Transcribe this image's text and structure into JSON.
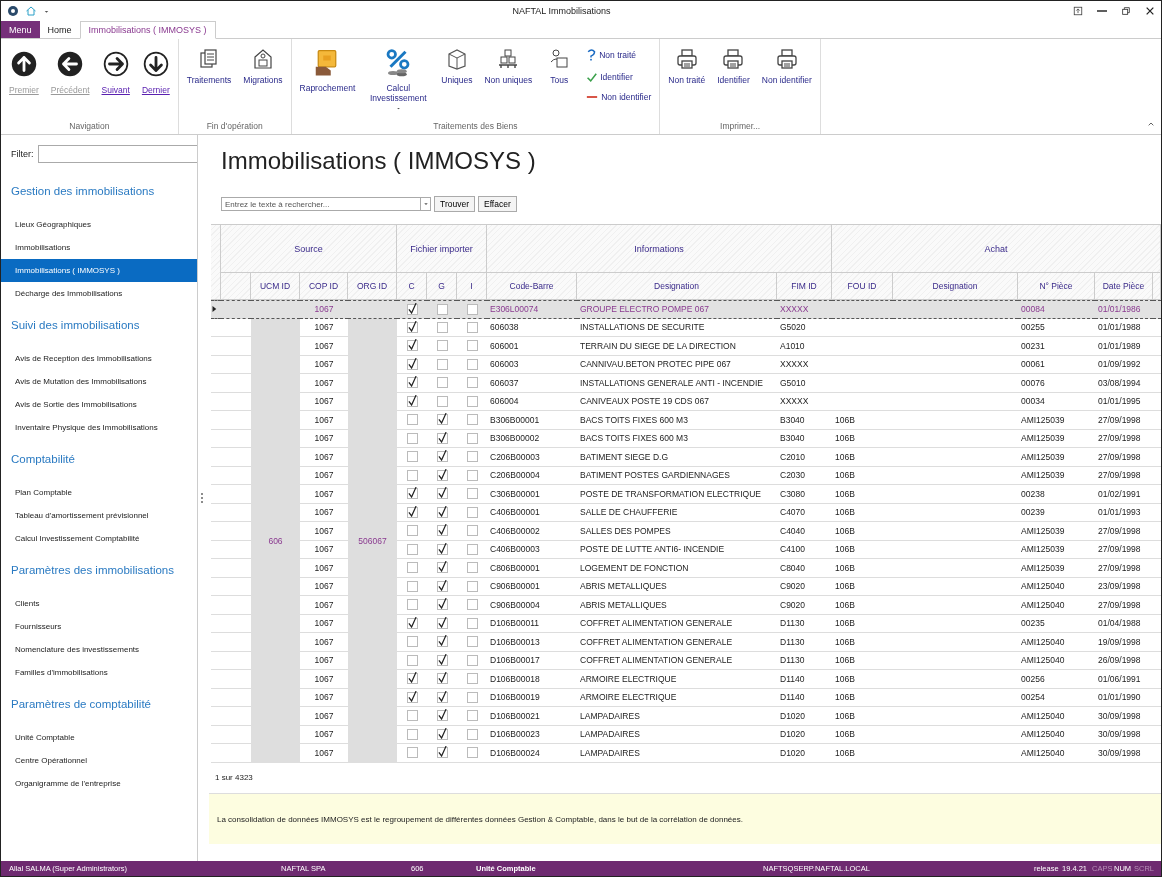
{
  "window": {
    "title": "NAFTAL Immobilisations"
  },
  "ribbon": {
    "tabs": [
      {
        "label": "Menu",
        "kind": "menu",
        "selected": false
      },
      {
        "label": "Home",
        "kind": "tab",
        "selected": false
      },
      {
        "label": "Immobilisations ( IMMOSYS )",
        "kind": "tab",
        "selected": true
      }
    ],
    "groups": [
      {
        "label": "Navigation",
        "buttons": [
          {
            "label": "Premier",
            "kind": "nav",
            "disabled": true
          },
          {
            "label": "Précédent",
            "kind": "nav",
            "disabled": true
          },
          {
            "label": "Suivant",
            "kind": "nav",
            "disabled": false
          },
          {
            "label": "Dernier",
            "kind": "nav",
            "disabled": false
          }
        ]
      },
      {
        "label": "Fin d'opération",
        "buttons": [
          {
            "label": "Traitements",
            "kind": "large",
            "disabled": false
          },
          {
            "label": "Migrations",
            "kind": "large",
            "disabled": false
          }
        ]
      },
      {
        "label": "Traitements des Biens",
        "buttons": [
          {
            "label": "Raprochement",
            "kind": "large",
            "disabled": false
          },
          {
            "label": "Calcul Investissement",
            "kind": "split",
            "disabled": false
          },
          {
            "label": "Uniques",
            "kind": "large",
            "disabled": false
          },
          {
            "label": "Non uniques",
            "kind": "large",
            "disabled": false
          },
          {
            "label": "Tous",
            "kind": "large",
            "disabled": false
          },
          {
            "label": "Non traité",
            "kind": "small",
            "disabled": false
          },
          {
            "label": "Identifier",
            "kind": "small",
            "disabled": false
          },
          {
            "label": "Non identifier",
            "kind": "small",
            "disabled": false
          }
        ]
      },
      {
        "label": "Imprimer...",
        "buttons": [
          {
            "label": "Non traité",
            "kind": "large",
            "disabled": false
          },
          {
            "label": "Identifier",
            "kind": "large",
            "disabled": false
          },
          {
            "label": "Non identifier",
            "kind": "large",
            "disabled": false
          }
        ]
      }
    ]
  },
  "sidebar": {
    "filter_label": "Filter:",
    "sections": [
      {
        "title": "Gestion des immobilisations",
        "items": [
          {
            "label": "Lieux Géographiques",
            "selected": false
          },
          {
            "label": "Immobilisations",
            "selected": false
          },
          {
            "label": "Immobilisations ( IMMOSYS )",
            "selected": true
          },
          {
            "label": "Décharge des Immobilisations",
            "selected": false
          }
        ]
      },
      {
        "title": "Suivi des immobilisations",
        "items": [
          {
            "label": "Avis de Reception des Immobilisations",
            "selected": false
          },
          {
            "label": "Avis de Mutation des Immobilisations",
            "selected": false
          },
          {
            "label": "Avis de Sortie des Immobilisations",
            "selected": false
          },
          {
            "label": "Inventaire Physique des Immobilisations",
            "selected": false
          }
        ]
      },
      {
        "title": "Comptabilité",
        "items": [
          {
            "label": "Plan Comptable",
            "selected": false
          },
          {
            "label": "Tableau d'amortissement prévisionnel",
            "selected": false
          },
          {
            "label": "Calcul Investissement Comptabilité",
            "selected": false
          }
        ]
      },
      {
        "title": "Paramètres des immobilisations",
        "items": [
          {
            "label": "Clients",
            "selected": false
          },
          {
            "label": "Fournisseurs",
            "selected": false
          },
          {
            "label": "Nomenclature des investissements",
            "selected": false
          },
          {
            "label": "Familles d'immobilisations",
            "selected": false
          }
        ]
      },
      {
        "title": "Paramètres de comptabilité",
        "items": [
          {
            "label": "Unité Comptable",
            "selected": false
          },
          {
            "label": "Centre Opérationnel",
            "selected": false
          },
          {
            "label": "Organigramme de l'entreprise",
            "selected": false
          }
        ]
      }
    ]
  },
  "page": {
    "title": "Immobilisations ( IMMOSYS )"
  },
  "search": {
    "placeholder": "Entrez le texte à rechercher...",
    "buttons": [
      "Trouver",
      "Effacer"
    ]
  },
  "table": {
    "groups": [
      {
        "label": "Source"
      },
      {
        "label": "Fichier importer"
      },
      {
        "label": "Informations"
      },
      {
        "label": "Achat"
      }
    ],
    "columns": [
      "UCM ID",
      "COP ID",
      "ORG ID",
      "C",
      "G",
      "I",
      "Code-Barre",
      "Designation",
      "FIM ID",
      "FOU ID",
      "Designation",
      "N° Pièce",
      "Date Pièce"
    ],
    "ucm_id": "606",
    "org_id": "506067",
    "rows": [
      {
        "selected": true,
        "cop_id": "1067",
        "c": true,
        "g": false,
        "i": false,
        "code_barre": "E306L00074",
        "designation": "GROUPE ELECTRO POMPE 067",
        "fim_id": "XXXXX",
        "n_piece": "00084",
        "date_piece": "01/01/1986"
      },
      {
        "selected": false,
        "cop_id": "1067",
        "c": true,
        "g": false,
        "i": false,
        "code_barre": "606038",
        "designation": "INSTALLATIONS DE SECURITE",
        "fim_id": "G5020",
        "n_piece": "00255",
        "date_piece": "01/01/1988"
      },
      {
        "selected": false,
        "cop_id": "1067",
        "c": true,
        "g": false,
        "i": false,
        "code_barre": "606001",
        "designation": "TERRAIN DU SIEGE DE LA DIRECTION",
        "fim_id": "A1010",
        "n_piece": "00231",
        "date_piece": "01/01/1989"
      },
      {
        "selected": false,
        "cop_id": "1067",
        "c": true,
        "g": false,
        "i": false,
        "code_barre": "606003",
        "designation": "CANNIVAU.BETON PROTEC PIPE 067",
        "fim_id": "XXXXX",
        "n_piece": "00061",
        "date_piece": "01/09/1992"
      },
      {
        "selected": false,
        "cop_id": "1067",
        "c": true,
        "g": false,
        "i": false,
        "code_barre": "606037",
        "designation": "INSTALLATIONS GENERALE  ANTI - INCENDIE",
        "fim_id": "G5010",
        "n_piece": "00076",
        "date_piece": "03/08/1994"
      },
      {
        "selected": false,
        "cop_id": "1067",
        "c": true,
        "g": false,
        "i": false,
        "code_barre": "606004",
        "designation": "CANIVEAUX POSTE 19 CDS 067",
        "fim_id": "XXXXX",
        "n_piece": "00034",
        "date_piece": "01/01/1995"
      },
      {
        "selected": false,
        "cop_id": "1067",
        "c": false,
        "g": true,
        "i": false,
        "code_barre": "B306B00001",
        "designation": "BACS TOITS FIXES 600 M3",
        "fim_id": "B3040",
        "fou_id": "106B",
        "n_piece": "AMI125039",
        "date_piece": "27/09/1998"
      },
      {
        "selected": false,
        "cop_id": "1067",
        "c": false,
        "g": true,
        "i": false,
        "code_barre": "B306B00002",
        "designation": "BACS TOITS FIXES 600 M3",
        "fim_id": "B3040",
        "fou_id": "106B",
        "n_piece": "AMI125039",
        "date_piece": "27/09/1998"
      },
      {
        "selected": false,
        "cop_id": "1067",
        "c": false,
        "g": true,
        "i": false,
        "code_barre": "C206B00003",
        "designation": "BATIMENT SIEGE D.G",
        "fim_id": "C2010",
        "fou_id": "106B",
        "n_piece": "AMI125039",
        "date_piece": "27/09/1998"
      },
      {
        "selected": false,
        "cop_id": "1067",
        "c": false,
        "g": true,
        "i": false,
        "code_barre": "C206B00004",
        "designation": "BATIMENT  POSTES GARDIENNAGES",
        "fim_id": "C2030",
        "fou_id": "106B",
        "n_piece": "AMI125039",
        "date_piece": "27/09/1998"
      },
      {
        "selected": false,
        "cop_id": "1067",
        "c": true,
        "g": true,
        "i": false,
        "code_barre": "C306B00001",
        "designation": "POSTE DE TRANSFORMATION ELECTRIQUE",
        "fim_id": "C3080",
        "fou_id": "106B",
        "n_piece": "00238",
        "date_piece": "01/02/1991"
      },
      {
        "selected": false,
        "cop_id": "1067",
        "c": true,
        "g": true,
        "i": false,
        "code_barre": "C406B00001",
        "designation": "SALLE DE CHAUFFERIE",
        "fim_id": "C4070",
        "fou_id": "106B",
        "n_piece": "00239",
        "date_piece": "01/01/1993"
      },
      {
        "selected": false,
        "cop_id": "1067",
        "c": false,
        "g": true,
        "i": false,
        "code_barre": "C406B00002",
        "designation": "SALLES DES POMPES",
        "fim_id": "C4040",
        "fou_id": "106B",
        "n_piece": "AMI125039",
        "date_piece": "27/09/1998"
      },
      {
        "selected": false,
        "cop_id": "1067",
        "c": false,
        "g": true,
        "i": false,
        "code_barre": "C406B00003",
        "designation": "POSTE DE LUTTE ANTI6- INCENDIE",
        "fim_id": "C4100",
        "fou_id": "106B",
        "n_piece": "AMI125039",
        "date_piece": "27/09/1998"
      },
      {
        "selected": false,
        "cop_id": "1067",
        "c": false,
        "g": true,
        "i": false,
        "code_barre": "C806B00001",
        "designation": "LOGEMENT DE FONCTION",
        "fim_id": "C8040",
        "fou_id": "106B",
        "n_piece": "AMI125039",
        "date_piece": "27/09/1998"
      },
      {
        "selected": false,
        "cop_id": "1067",
        "c": false,
        "g": true,
        "i": false,
        "code_barre": "C906B00001",
        "designation": "ABRIS METALLIQUES",
        "fim_id": "C9020",
        "fou_id": "106B",
        "n_piece": "AMI125040",
        "date_piece": "23/09/1998"
      },
      {
        "selected": false,
        "cop_id": "1067",
        "c": false,
        "g": true,
        "i": false,
        "code_barre": "C906B00004",
        "designation": "ABRIS METALLIQUES",
        "fim_id": "C9020",
        "fou_id": "106B",
        "n_piece": "AMI125040",
        "date_piece": "27/09/1998"
      },
      {
        "selected": false,
        "cop_id": "1067",
        "c": true,
        "g": true,
        "i": false,
        "code_barre": "D106B00011",
        "designation": "COFFRET ALIMENTATION  GENERALE",
        "fim_id": "D1130",
        "fou_id": "106B",
        "n_piece": "00235",
        "date_piece": "01/04/1988"
      },
      {
        "selected": false,
        "cop_id": "1067",
        "c": false,
        "g": true,
        "i": false,
        "code_barre": "D106B00013",
        "designation": "COFFRET ALIMENTATION  GENERALE",
        "fim_id": "D1130",
        "fou_id": "106B",
        "n_piece": "AMI125040",
        "date_piece": "19/09/1998"
      },
      {
        "selected": false,
        "cop_id": "1067",
        "c": false,
        "g": true,
        "i": false,
        "code_barre": "D106B00017",
        "designation": "COFFRET ALIMENTATION  GENERALE",
        "fim_id": "D1130",
        "fou_id": "106B",
        "n_piece": "AMI125040",
        "date_piece": "26/09/1998"
      },
      {
        "selected": false,
        "cop_id": "1067",
        "c": true,
        "g": true,
        "i": false,
        "code_barre": "D106B00018",
        "designation": "ARMOIRE ELECTRIQUE",
        "fim_id": "D1140",
        "fou_id": "106B",
        "n_piece": "00256",
        "date_piece": "01/06/1991"
      },
      {
        "selected": false,
        "cop_id": "1067",
        "c": true,
        "g": true,
        "i": false,
        "code_barre": "D106B00019",
        "designation": "ARMOIRE ELECTRIQUE",
        "fim_id": "D1140",
        "fou_id": "106B",
        "n_piece": "00254",
        "date_piece": "01/01/1990"
      },
      {
        "selected": false,
        "cop_id": "1067",
        "c": false,
        "g": true,
        "i": false,
        "code_barre": "D106B00021",
        "designation": "LAMPADAIRES",
        "fim_id": "D1020",
        "fou_id": "106B",
        "n_piece": "AMI125040",
        "date_piece": "30/09/1998"
      },
      {
        "selected": false,
        "cop_id": "1067",
        "c": false,
        "g": true,
        "i": false,
        "code_barre": "D106B00023",
        "designation": "LAMPADAIRES",
        "fim_id": "D1020",
        "fou_id": "106B",
        "n_piece": "AMI125040",
        "date_piece": "30/09/1998"
      },
      {
        "selected": false,
        "cop_id": "1067",
        "c": false,
        "g": true,
        "i": false,
        "code_barre": "D106B00024",
        "designation": "LAMPADAIRES",
        "fim_id": "D1020",
        "fou_id": "106B",
        "n_piece": "AMI125040",
        "date_piece": "30/09/1998"
      }
    ],
    "record_count": "1 sur 4323"
  },
  "help_text": "La consolidation de données IMMOSYS est le regroupement de différentes données Gestion & Comptable, dans le but de la corrélation de données.",
  "status_bar": [
    {
      "text": "Allal SALMA (Super Administrators)",
      "on": true
    },
    {
      "text": "NAFTAL SPA",
      "on": true
    },
    {
      "text": "606",
      "on": true
    },
    {
      "text": "Unité Comptable",
      "on": true
    },
    {
      "text": "NAFTSQSERP.NAFTAL.LOCAL",
      "on": true
    },
    {
      "text": "release",
      "on": true
    },
    {
      "text": "19.4.21",
      "on": true
    },
    {
      "text": "CAPS",
      "on": false
    },
    {
      "text": "NUM",
      "on": true
    },
    {
      "text": "SCRL",
      "on": false
    }
  ]
}
